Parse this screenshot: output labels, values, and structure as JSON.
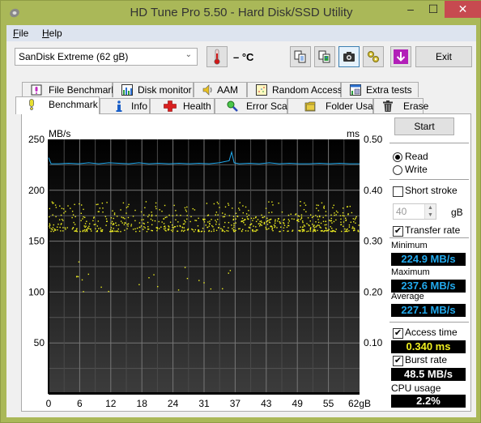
{
  "window": {
    "title": "HD Tune Pro 5.50 - Hard Disk/SSD Utility",
    "controls": {
      "minimize": "‒",
      "maximize": "☐",
      "close": "✕"
    }
  },
  "menu": {
    "items": [
      {
        "label": "File",
        "accel": "F"
      },
      {
        "label": "Help",
        "accel": "H"
      }
    ]
  },
  "toolbar": {
    "drive": "SanDisk Extreme (62 gB)",
    "temperature": "– °C",
    "exit_label": "Exit",
    "icons": [
      "copy-text-icon",
      "copy-screenshot-icon",
      "camera-icon",
      "options-icon",
      "save-icon"
    ]
  },
  "tabs": {
    "row_back": [
      "File Benchmark",
      "Disk monitor",
      "AAM",
      "Random Access",
      "Extra tests"
    ],
    "row_front": [
      "Benchmark",
      "Info",
      "Health",
      "Error Scan",
      "Folder Usage",
      "Erase"
    ],
    "selected": "Benchmark"
  },
  "side": {
    "start_label": "Start",
    "read_label": "Read",
    "write_label": "Write",
    "mode": "Read",
    "short_stroke_label": "Short stroke",
    "short_stroke_checked": false,
    "short_stroke_value": "40",
    "short_stroke_unit": "gB",
    "transfer_rate_label": "Transfer rate",
    "transfer_rate_checked": true,
    "minimum_label": "Minimum",
    "minimum_value": "224.9 MB/s",
    "maximum_label": "Maximum",
    "maximum_value": "237.6 MB/s",
    "average_label": "Average",
    "average_value": "227.1 MB/s",
    "access_time_label": "Access time",
    "access_time_checked": true,
    "access_time_value": "0.340 ms",
    "burst_rate_label": "Burst rate",
    "burst_rate_checked": true,
    "burst_rate_value": "48.5 MB/s",
    "cpu_label": "CPU usage",
    "cpu_value": "2.2%",
    "colors": {
      "transfer": "#22aaee",
      "access": "#f0f020",
      "cpu": "#ffffff"
    }
  },
  "chart_data": {
    "type": "line",
    "title": "",
    "xlabel": "gB",
    "ylabel": "MB/s",
    "y2label": "ms",
    "xlim": [
      0,
      62
    ],
    "ylim": [
      0,
      250
    ],
    "y2lim": [
      0,
      0.5
    ],
    "x_ticks": [
      "0",
      "6",
      "12",
      "18",
      "24",
      "31",
      "37",
      "43",
      "49",
      "55",
      "62gB"
    ],
    "y_ticks": [
      "250",
      "200",
      "150",
      "100",
      "50"
    ],
    "y2_ticks": [
      "0.50",
      "0.40",
      "0.30",
      "0.20",
      "0.10"
    ],
    "grid": true,
    "series": [
      {
        "name": "Transfer rate",
        "kind": "line",
        "color": "#22aaee",
        "axis": "left",
        "x": [
          0,
          0.5,
          2,
          4,
          6,
          8,
          10,
          12,
          14,
          16,
          18,
          20,
          22,
          24,
          26,
          28,
          30,
          32,
          34,
          36,
          36.5,
          37,
          38,
          40,
          42,
          44,
          46,
          48,
          50,
          52,
          54,
          56,
          58,
          60,
          62
        ],
        "y": [
          232,
          226,
          226,
          226.5,
          226,
          227,
          226,
          227,
          226.5,
          226,
          227,
          226,
          226.5,
          226,
          226.5,
          226,
          226.5,
          226,
          227,
          229,
          237.6,
          227,
          226,
          226.5,
          226,
          227,
          226,
          226.5,
          226,
          226,
          226.5,
          226,
          226.5,
          226,
          226
        ]
      },
      {
        "name": "Access time",
        "kind": "scatter",
        "color": "#f0f020",
        "axis": "right",
        "cluster_center_ms": 0.34,
        "cluster_spread_ms": [
          0.32,
          0.38
        ],
        "outlier_band_ms": [
          0.2,
          0.25
        ]
      }
    ]
  }
}
